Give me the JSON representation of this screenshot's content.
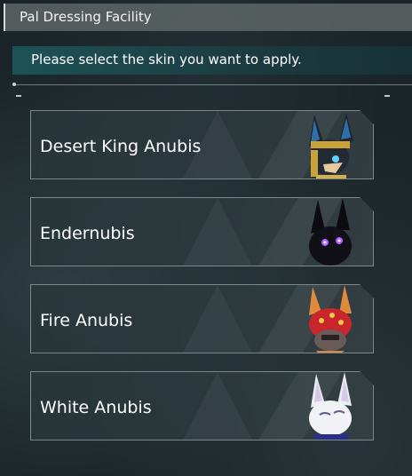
{
  "window": {
    "title": "Pal Dressing Facility"
  },
  "prompt": "Please select the skin you want to apply.",
  "skins": [
    {
      "label": "Desert King Anubis",
      "icon": "desert-king-anubis-portrait"
    },
    {
      "label": "Endernubis",
      "icon": "endernubis-portrait"
    },
    {
      "label": "Fire Anubis",
      "icon": "fire-anubis-portrait"
    },
    {
      "label": "White Anubis",
      "icon": "white-anubis-portrait"
    }
  ],
  "colors": {
    "accent_teal": "#1e787d",
    "card_border": "#bec8c8",
    "text": "#ffffff"
  }
}
